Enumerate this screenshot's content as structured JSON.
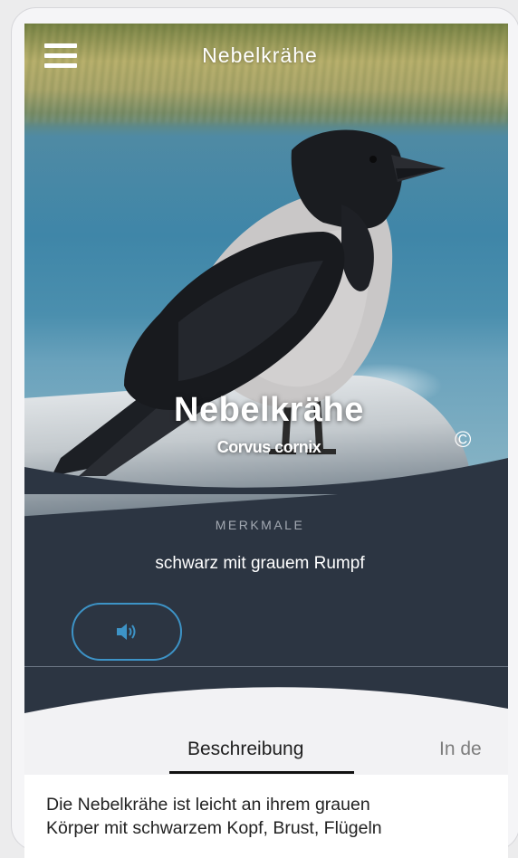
{
  "header": {
    "title": "Nebelkrähe"
  },
  "bird": {
    "common_name": "Nebelkrähe",
    "scientific_name": "Corvus cornix",
    "copyright_symbol": "©"
  },
  "features": {
    "label": "MERKMALE",
    "text": "schwarz mit grauem Rumpf"
  },
  "audio": {
    "icon": "speaker-icon",
    "accent": "#3d93c6"
  },
  "tabs": [
    {
      "label": "Beschreibung",
      "active": true
    },
    {
      "label": "In de",
      "active": false
    }
  ],
  "description": {
    "line1": "Die Nebelkrähe ist leicht an ihrem grauen",
    "line2": "Körper mit schwarzem Kopf, Brust, Flügeln"
  },
  "colors": {
    "panel": "#2c3542",
    "muted": "#a3a9b2"
  }
}
